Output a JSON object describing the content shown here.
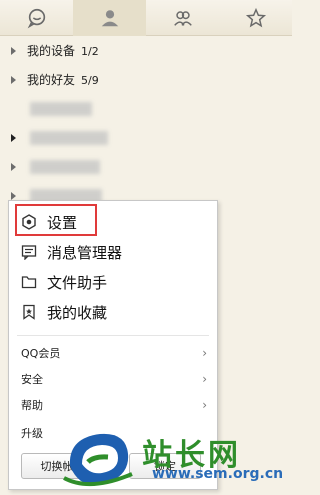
{
  "tabs": [
    {
      "icon": "chat-bubble-icon"
    },
    {
      "icon": "person-icon"
    },
    {
      "icon": "group-icon"
    },
    {
      "icon": "star-icon"
    }
  ],
  "contacts": {
    "groups": [
      {
        "label": "我的设备",
        "count": "1/2"
      },
      {
        "label": "我的好友",
        "count": "5/9"
      }
    ]
  },
  "menu": {
    "items": [
      {
        "label": "设置",
        "icon": "settings-hexagon-icon"
      },
      {
        "label": "消息管理器",
        "icon": "message-manager-icon"
      },
      {
        "label": "文件助手",
        "icon": "folder-icon"
      },
      {
        "label": "我的收藏",
        "icon": "bookmark-icon"
      }
    ],
    "submenus": [
      {
        "label": "QQ会员"
      },
      {
        "label": "安全"
      },
      {
        "label": "帮助"
      },
      {
        "label": "升级"
      }
    ],
    "buttons": {
      "switch_label": "切换帐",
      "right_label": "锁定"
    }
  },
  "watermark": {
    "title": "站长网",
    "url": "www.sem.org.cn"
  },
  "colors": {
    "highlight": "#e03a3a",
    "watermark_green": "#2f8e2b",
    "watermark_blue": "#2a6cb8"
  }
}
